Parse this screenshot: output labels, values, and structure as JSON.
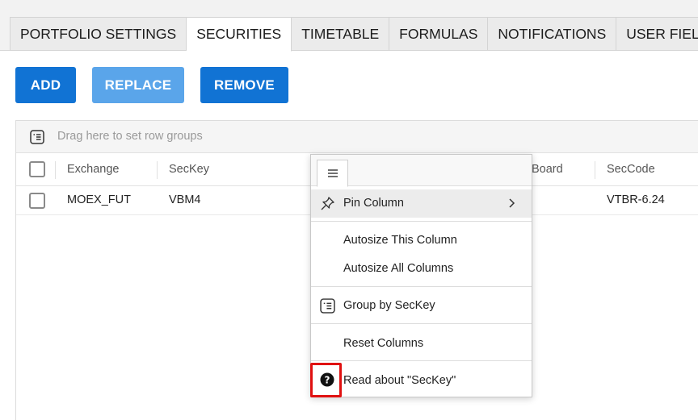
{
  "tabs": [
    {
      "label": "PORTFOLIO SETTINGS",
      "active": false
    },
    {
      "label": "SECURITIES",
      "active": true
    },
    {
      "label": "TIMETABLE",
      "active": false
    },
    {
      "label": "FORMULAS",
      "active": false
    },
    {
      "label": "NOTIFICATIONS",
      "active": false
    },
    {
      "label": "USER FIELDS",
      "active": false
    }
  ],
  "toolbar": {
    "add_label": "ADD",
    "replace_label": "REPLACE",
    "remove_label": "REMOVE"
  },
  "grid": {
    "group_panel_text": "Drag here to set row groups",
    "columns": [
      "Exchange",
      "SecKey",
      "Board",
      "SecCode"
    ],
    "rows": [
      {
        "exchange": "MOEX_FUT",
        "seckey": "VBM4",
        "seccode": "VTBR-6.24"
      }
    ]
  },
  "column_menu": {
    "pin_column": "Pin Column",
    "autosize_this": "Autosize This Column",
    "autosize_all": "Autosize All Columns",
    "group_by": "Group by SecKey",
    "reset_columns": "Reset Columns",
    "read_about": "Read about \"SecKey\""
  },
  "colors": {
    "primary": "#1173d4",
    "primary_disabled": "#5aa5ea",
    "highlight": "#e01010"
  },
  "icons": [
    "menu-icon",
    "pin-icon",
    "chevron-right-icon",
    "group-rows-icon",
    "help-circle-icon"
  ]
}
